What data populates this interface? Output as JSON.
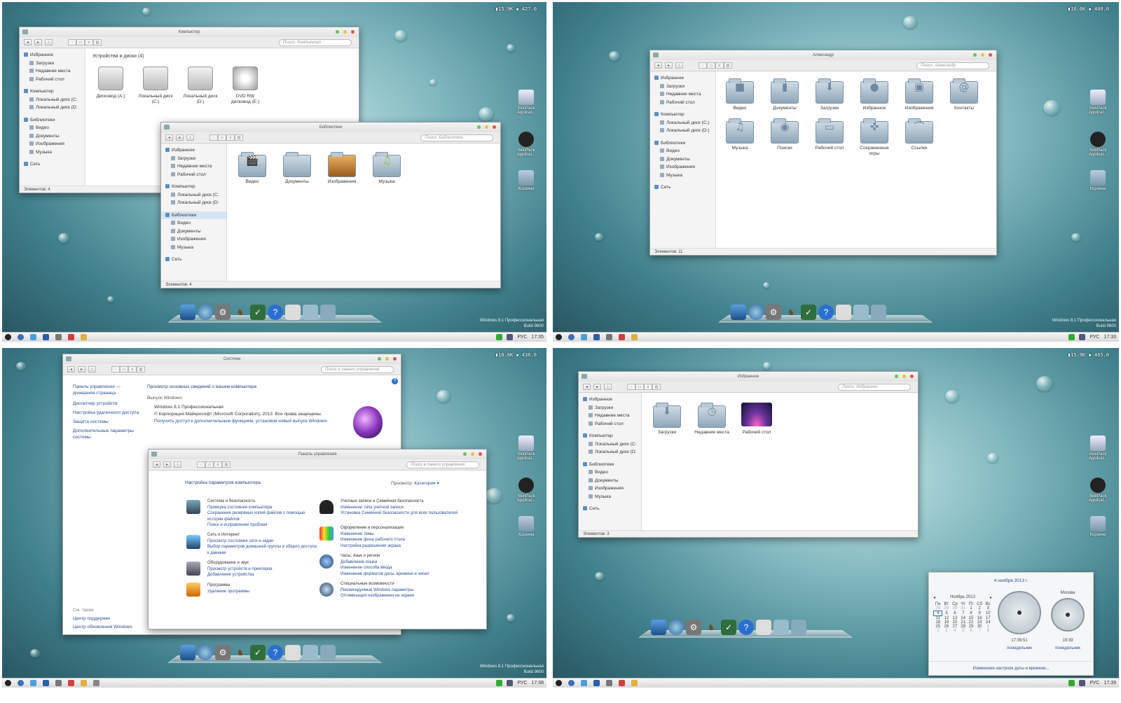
{
  "shared": {
    "edition_line1": "Windows 8.1 Профессиональная",
    "edition_line2": "Build 9600",
    "desktop_icons": [
      "SkinPack Applicat...",
      "SkinPack Applicat...",
      "Корзина"
    ],
    "tray_lang": "РУС",
    "colors": {
      "light_red": "#e0534a",
      "light_yellow": "#e8c23a",
      "light_green": "#66c05a",
      "link": "#2a4f8e"
    }
  },
  "q1": {
    "stats": "▮15.9K ▪ 427.0",
    "time": "17:35",
    "computer_window": {
      "title": "Компьютер",
      "search": "Поиск: Компьютер",
      "group": "Устройства и диски (4)",
      "sidebar": [
        "Избранное",
        "Загрузки",
        "Недавние места",
        "Рабочий стол",
        "Компьютер",
        "Локальный диск (C:",
        "Локальный диск (D:",
        "Библиотеки",
        "Видео",
        "Документы",
        "Изображения",
        "Музыка",
        "Сеть"
      ],
      "items": [
        "Дисковод (A:)",
        "Локальный диск (C:)",
        "Локальный диск (D:)",
        "DVD RW дисковод (E:)"
      ],
      "status": "Элементов: 4"
    },
    "libraries_window": {
      "title": "Библиотеки",
      "search": "Поиск: Библиотеки",
      "sidebar": [
        "Избранное",
        "Загрузки",
        "Недавние места",
        "Рабочий стол",
        "Компьютер",
        "Локальный диск (C:",
        "Локальный диск (D:",
        "Библиотеки",
        "Видео",
        "Документы",
        "Изображения",
        "Музыка",
        "Сеть"
      ],
      "items": [
        "Видео",
        "Документы",
        "Изображения",
        "Музыка"
      ],
      "status": "Элементов: 4"
    }
  },
  "q2": {
    "stats": "▮16.6K ▪ 408.0",
    "time": "17:33",
    "user_window": {
      "title": "Александр",
      "search": "Поиск: Александр",
      "sidebar": [
        "Избранное",
        "Загрузки",
        "Недавние места",
        "Рабочий стол",
        "Компьютер",
        "Локальный диск (C:)",
        "Локальный диск (D:)",
        "Библиотеки",
        "Видео",
        "Документы",
        "Изображения",
        "Музыка",
        "Сеть"
      ],
      "items": [
        "Видео",
        "Документы",
        "Загрузки",
        "Избранное",
        "Изображения",
        "Контакты",
        "Музыка",
        "Поиски",
        "Рабочий стол",
        "Сохраненные игры",
        "Ссылки"
      ],
      "status": "Элементов: 11"
    }
  },
  "q3": {
    "stats": "▮16.6K ▪ 436.0",
    "time": "17:38",
    "system_window": {
      "title": "Система",
      "search": "Поиск в панели управления",
      "side_links": [
        "Панель управления — домашняя страница",
        "Диспетчер устройств",
        "Настройка удаленного доступа",
        "Защита системы",
        "Дополнительные параметры системы"
      ],
      "see_also": "См. также",
      "see_also_links": [
        "Центр поддержки",
        "Центр обновления Windows"
      ],
      "heading": "Просмотр основных сведений о вашем компьютере",
      "edition_label": "Выпуск Windows",
      "edition": "Windows 8.1 Профессиональная",
      "copyright": "© Корпорация Майкрософт (Microsoft Corporation), 2013. Все права защищены.",
      "upgrade_link": "Получить доступ к дополнительным функциям, установив новый выпуск Windows"
    },
    "control_panel": {
      "title": "Панель управления",
      "search": "Поиск в панели управления",
      "heading": "Настройка параметров компьютера",
      "view_label": "Просмотр:",
      "view_value": "Категория ▾",
      "left": [
        {
          "title": "Система и безопасность",
          "links": [
            "Проверка состояния компьютера",
            "Сохранение резервных копий файлов с помощью истории файлов",
            "Поиск и исправление проблем"
          ]
        },
        {
          "title": "Сеть и Интернет",
          "links": [
            "Просмотр состояния сети и задач",
            "Выбор параметров домашней группы и общего доступа к данным"
          ]
        },
        {
          "title": "Оборудование и звук",
          "links": [
            "Просмотр устройств и принтеров",
            "Добавление устройства"
          ]
        },
        {
          "title": "Программы",
          "links": [
            "Удаление программы"
          ]
        }
      ],
      "right": [
        {
          "title": "Учетные записи и Семейная безопасность",
          "links": [
            "Изменение типа учетной записи",
            "Установка Семейной безопасности для всех пользователей"
          ]
        },
        {
          "title": "Оформление и персонализация",
          "links": [
            "Изменение темы",
            "Изменение фона рабочего стола",
            "Настройка разрешения экрана"
          ]
        },
        {
          "title": "Часы, язык и регион",
          "links": [
            "Добавление языка",
            "Изменение способа ввода",
            "Изменение форматов даты, времени и чисел"
          ]
        },
        {
          "title": "Специальные возможности",
          "links": [
            "Рекомендуемые Windows параметры",
            "Оптимизация изображения на экране"
          ]
        }
      ]
    }
  },
  "q4": {
    "stats": "▮15.9K ▪ 465.0",
    "time": "17:39",
    "favorites_window": {
      "title": "Избранное",
      "search": "Поиск: Избранное",
      "sidebar": [
        "Избранное",
        "Загрузки",
        "Недавние места",
        "Рабочий стол",
        "Компьютер",
        "Локальный диск (C:",
        "Локальный диск (D:",
        "Библиотеки",
        "Видео",
        "Документы",
        "Изображения",
        "Музыка",
        "Сеть"
      ],
      "items": [
        "Загрузки",
        "Недавние места",
        "Рабочий стол"
      ],
      "status": "Элементов: 3"
    },
    "calendar": {
      "date_header": "4 ноября 2013 г.",
      "month": "Ноябрь 2013",
      "weekdays": [
        "Пн",
        "Вт",
        "Ср",
        "Чт",
        "Пт",
        "Сб",
        "Вс"
      ],
      "weeks": [
        [
          "28",
          "29",
          "30",
          "31",
          "1",
          "2",
          "3"
        ],
        [
          "4",
          "5",
          "6",
          "7",
          "8",
          "9",
          "10"
        ],
        [
          "11",
          "12",
          "13",
          "14",
          "15",
          "16",
          "17"
        ],
        [
          "18",
          "19",
          "20",
          "21",
          "22",
          "23",
          "24"
        ],
        [
          "25",
          "26",
          "27",
          "28",
          "29",
          "30",
          "1"
        ],
        [
          "2",
          "3",
          "4",
          "5",
          "6",
          "7",
          "8"
        ]
      ],
      "clock1_time": "17:39:51",
      "clock1_day": "понедельник",
      "clock2_city": "Москва",
      "clock2_time": "19:39",
      "clock2_day": "понедельник",
      "footer_link": "Изменение настроек даты и времени..."
    }
  }
}
